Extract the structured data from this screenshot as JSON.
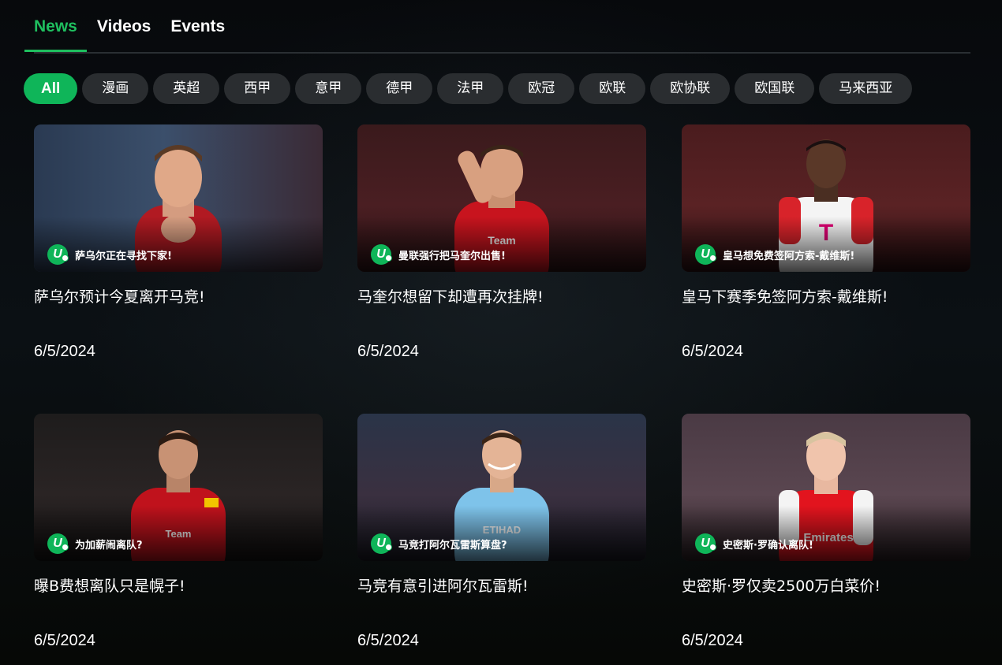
{
  "tabs": [
    {
      "label": "News",
      "active": true
    },
    {
      "label": "Videos",
      "active": false
    },
    {
      "label": "Events",
      "active": false
    }
  ],
  "filters": [
    {
      "label": "All",
      "active": true
    },
    {
      "label": "漫画",
      "active": false
    },
    {
      "label": "英超",
      "active": false
    },
    {
      "label": "西甲",
      "active": false
    },
    {
      "label": "意甲",
      "active": false
    },
    {
      "label": "德甲",
      "active": false
    },
    {
      "label": "法甲",
      "active": false
    },
    {
      "label": "欧冠",
      "active": false
    },
    {
      "label": "欧联",
      "active": false
    },
    {
      "label": "欧协联",
      "active": false
    },
    {
      "label": "欧国联",
      "active": false
    },
    {
      "label": "马来西亚",
      "active": false
    }
  ],
  "colors": {
    "accent": "#1fbf5f",
    "chip_bg": "#2a2d30",
    "background": "#06090c"
  },
  "brand_logo": "U",
  "articles": [
    {
      "badge": "萨乌尔正在寻找下家!",
      "title": "萨乌尔预计今夏离开马竞!",
      "date": "6/5/2024"
    },
    {
      "badge": "曼联强行把马奎尔出售!",
      "title": "马奎尔想留下却遭再次挂牌!",
      "date": "6/5/2024"
    },
    {
      "badge": "皇马想免费签阿方索-戴维斯!",
      "title": "皇马下赛季免签阿方索-戴维斯!",
      "date": "6/5/2024"
    },
    {
      "badge": "为加薪闹离队?",
      "title": "曝B费想离队只是幌子!",
      "date": "6/5/2024"
    },
    {
      "badge": "马竞打阿尔瓦雷斯算盘?",
      "title": "马竞有意引进阿尔瓦雷斯!",
      "date": "6/5/2024"
    },
    {
      "badge": "史密斯·罗确认离队!",
      "title": "史密斯·罗仅卖2500万白菜价!",
      "date": "6/5/2024"
    }
  ]
}
